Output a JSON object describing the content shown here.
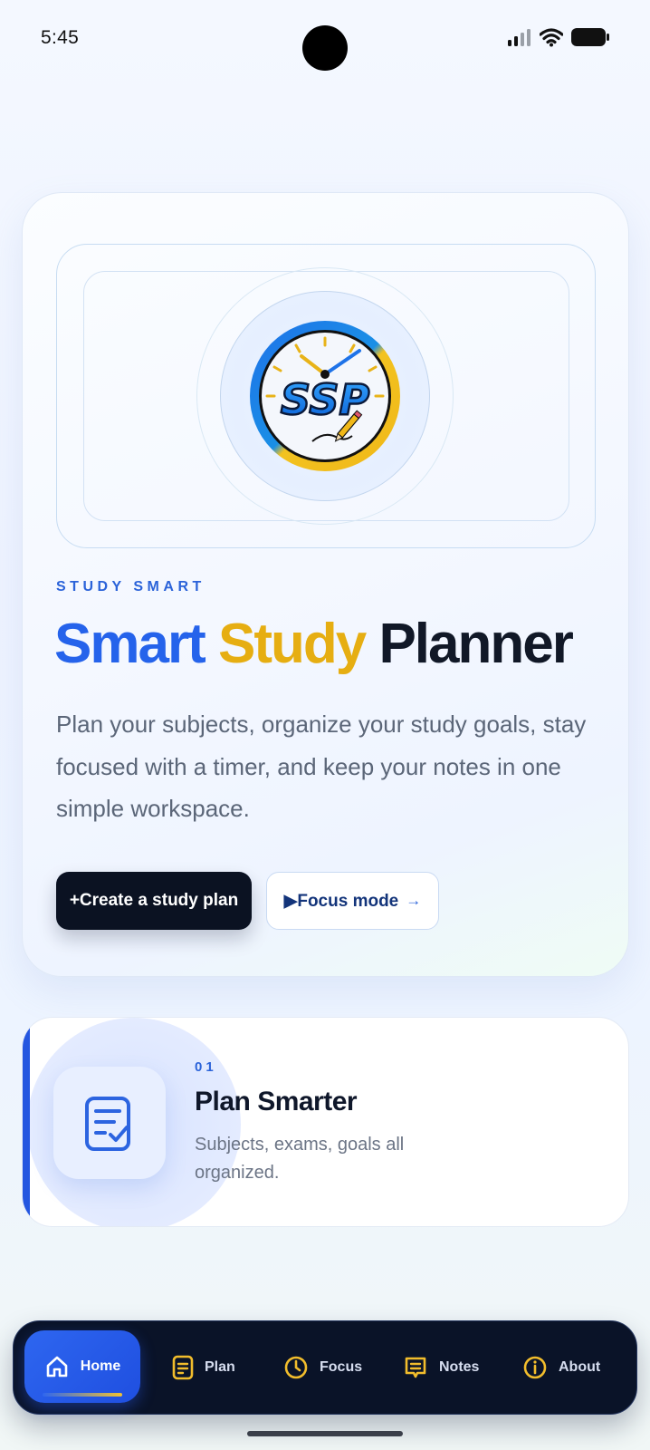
{
  "status_bar": {
    "time": "5:45"
  },
  "hero": {
    "eyebrow": "STUDY SMART",
    "title_part1": "Smart",
    "title_part2": "Study",
    "title_part3": "Planner",
    "description": "Plan your subjects, organize your study goals, stay focused with a timer, and keep your notes in one simple workspace.",
    "primary_button": "+Create a study plan",
    "secondary_button": "▶Focus mode",
    "secondary_arrow": "→",
    "logo_text": "SSP"
  },
  "feature": {
    "number": "01",
    "title": "Plan Smarter",
    "description": "Subjects, exams, goals all organized."
  },
  "nav": {
    "items": [
      {
        "label": "Home",
        "icon": "home-icon"
      },
      {
        "label": "Plan",
        "icon": "document-icon"
      },
      {
        "label": "Focus",
        "icon": "clock-icon"
      },
      {
        "label": "Notes",
        "icon": "notes-icon"
      },
      {
        "label": "About",
        "icon": "info-icon"
      }
    ]
  },
  "colors": {
    "accent_blue": "#2563eb",
    "accent_gold": "#e6ae12",
    "dark": "#0b1222"
  }
}
